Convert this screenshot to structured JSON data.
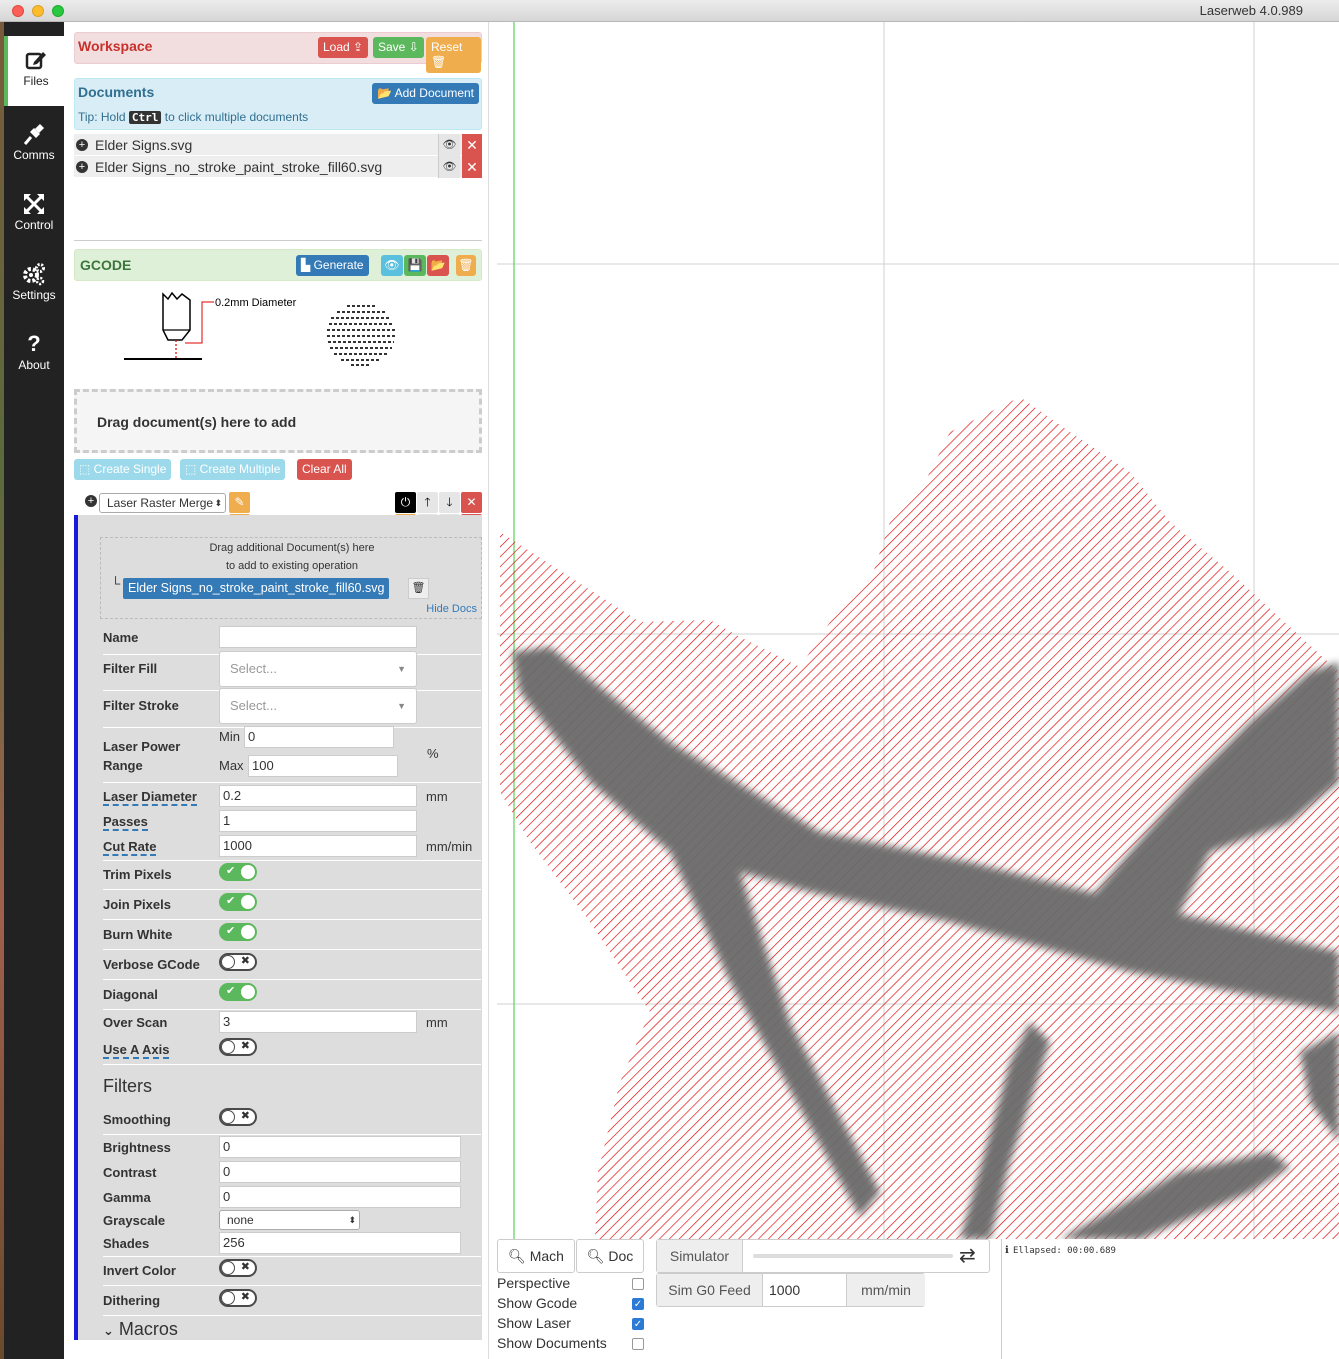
{
  "window": {
    "title": "Laserweb 4.0.989"
  },
  "nav": [
    {
      "label": "Files",
      "icon": "edit-icon"
    },
    {
      "label": "Comms",
      "icon": "plug-icon"
    },
    {
      "label": "Control",
      "icon": "arrows-icon"
    },
    {
      "label": "Settings",
      "icon": "gears-icon"
    },
    {
      "label": "About",
      "icon": "question-icon"
    }
  ],
  "workspace": {
    "title": "Workspace",
    "load": "Load",
    "save": "Save",
    "reset": "Reset"
  },
  "documents": {
    "title": "Documents",
    "add": "Add Document",
    "tip_prefix": "Tip: Hold",
    "tip_key": "Ctrl",
    "tip_suffix": "to click multiple documents",
    "items": [
      "Elder Signs.svg",
      "Elder Signs_no_stroke_paint_stroke_fill60.svg"
    ]
  },
  "gcode": {
    "title": "GCODE",
    "generate": "Generate",
    "diameter_label": "0.2mm Diameter",
    "drag_text": "Drag document(s) here to add",
    "create_single": "Create Single",
    "create_multiple": "Create Multiple",
    "clear_all": "Clear All"
  },
  "operations": [
    {
      "type": "Laser Raster Merge",
      "expanded": false
    },
    {
      "type": "Laser Raster Merge",
      "expanded": true
    }
  ],
  "op_detail": {
    "drag_line1": "Drag additional Document(s) here",
    "drag_line2": "to add to existing operation",
    "doc_tag": "Elder Signs_no_stroke_paint_stroke_fill60.svg",
    "hide_docs": "Hide Docs",
    "name_label": "Name",
    "name_value": "",
    "filter_fill_label": "Filter Fill",
    "filter_fill_placeholder": "Select...",
    "filter_stroke_label": "Filter Stroke",
    "filter_stroke_placeholder": "Select...",
    "power_label_1": "Laser Power",
    "power_label_2": "Range",
    "min_label": "Min",
    "min_value": "0",
    "max_label": "Max",
    "max_value": "100",
    "percent": "%",
    "diameter_label": "Laser Diameter",
    "diameter_value": "0.2",
    "mm": "mm",
    "passes_label": "Passes",
    "passes_value": "1",
    "cut_rate_label": "Cut Rate",
    "cut_rate_value": "1000",
    "mm_min": "mm/min",
    "trim_pixels": "Trim Pixels",
    "join_pixels": "Join Pixels",
    "burn_white": "Burn White",
    "verbose_gcode": "Verbose GCode",
    "diagonal": "Diagonal",
    "over_scan_label": "Over Scan",
    "over_scan_value": "3",
    "use_a_axis": "Use A Axis",
    "filters_title": "Filters",
    "smoothing": "Smoothing",
    "brightness_label": "Brightness",
    "brightness_value": "0",
    "contrast_label": "Contrast",
    "contrast_value": "0",
    "gamma_label": "Gamma",
    "gamma_value": "0",
    "grayscale_label": "Grayscale",
    "grayscale_value": "none",
    "shades_label": "Shades",
    "shades_value": "256",
    "invert_color": "Invert Color",
    "dithering": "Dithering",
    "macros": "Macros"
  },
  "toggles": {
    "trim_pixels": true,
    "join_pixels": true,
    "burn_white": true,
    "verbose_gcode": false,
    "diagonal": true,
    "use_a_axis": false,
    "smoothing": false,
    "invert_color": false,
    "dithering": false
  },
  "bottom": {
    "mach": "Mach",
    "doc": "Doc",
    "perspective": "Perspective",
    "show_gcode": "Show Gcode",
    "show_laser": "Show Laser",
    "show_documents": "Show Documents",
    "simulator": "Simulator",
    "sim_feed_label": "Sim G0 Feed",
    "sim_feed_value": "1000",
    "sim_feed_unit": "mm/min",
    "elapsed": "Ellapsed: 00:00.689"
  },
  "checks": {
    "perspective": false,
    "show_gcode": true,
    "show_laser": true,
    "show_documents": false
  },
  "colors": {
    "accent": "#5cb85c",
    "danger": "#d9534f",
    "primary": "#337ab7",
    "warning": "#f0ad4e",
    "gcode_lines": "#e00000",
    "raster": "#666666"
  }
}
